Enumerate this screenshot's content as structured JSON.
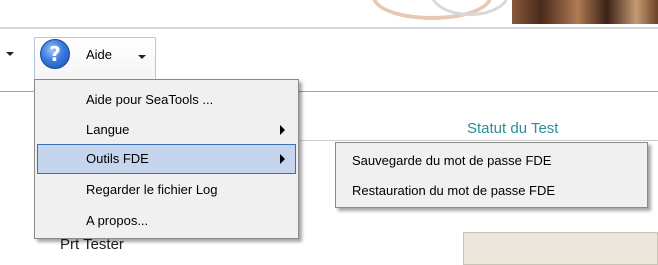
{
  "toolbar": {
    "help_icon": "help-question-icon",
    "aide_label": "Aide"
  },
  "menu": {
    "items": [
      {
        "label": "Aide pour SeaTools ...",
        "has_submenu": false
      },
      {
        "label": "Langue",
        "has_submenu": true
      },
      {
        "label": "Outils FDE",
        "has_submenu": true,
        "selected": true
      },
      {
        "label": "Regarder le fichier Log",
        "has_submenu": false
      },
      {
        "label": "A propos...",
        "has_submenu": false
      }
    ]
  },
  "submenu": {
    "items": [
      {
        "label": "Sauvegarde du mot de passe FDE"
      },
      {
        "label": "Restauration du mot de passe FDE"
      }
    ]
  },
  "content": {
    "statut_label": "Statut du Test",
    "prt_tester": "Prt Tester"
  },
  "colors": {
    "selection_bg": "#c5d5ee",
    "selection_border": "#3c6fb3",
    "statut_text": "#2a8f96",
    "menu_bg": "#f0f0f0"
  }
}
